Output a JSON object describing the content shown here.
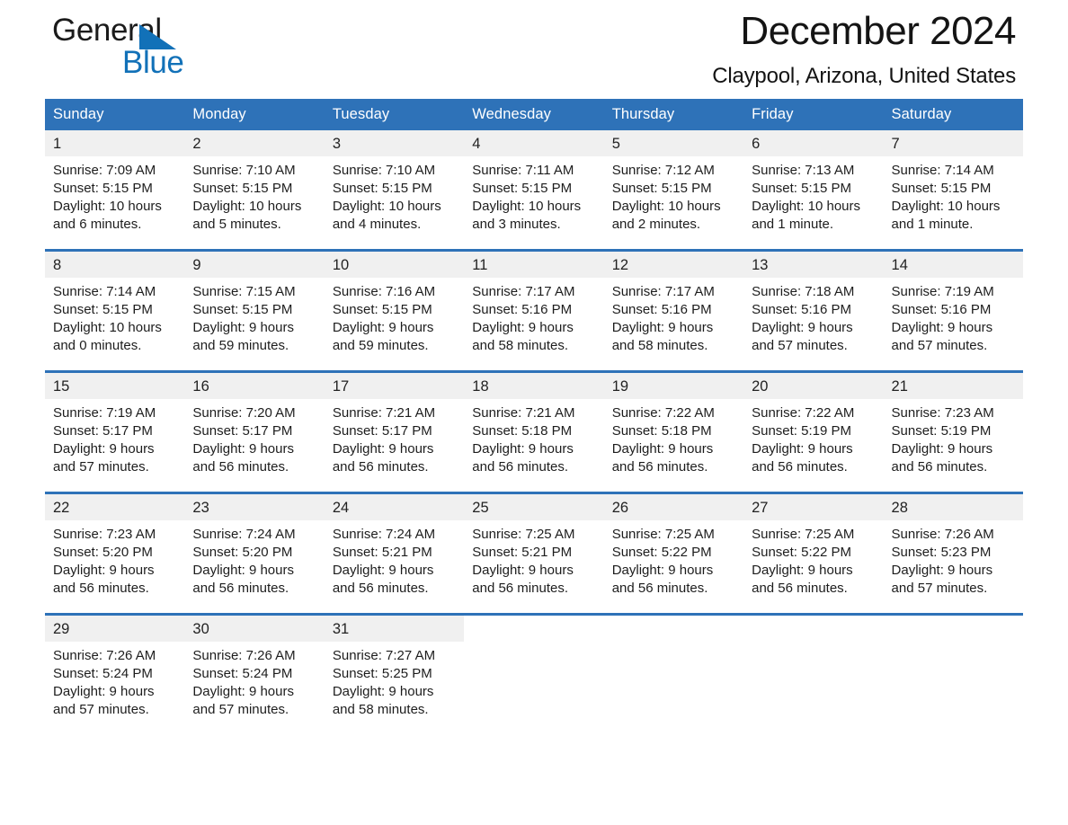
{
  "brand": {
    "word1": "General",
    "word2": "Blue",
    "accent_color": "#1271b8"
  },
  "header": {
    "month_title": "December 2024",
    "location": "Claypool, Arizona, United States",
    "header_bg_color": "#2e72b8",
    "daynum_bg_color": "#f0f0f0"
  },
  "weekday_headers": [
    "Sunday",
    "Monday",
    "Tuesday",
    "Wednesday",
    "Thursday",
    "Friday",
    "Saturday"
  ],
  "weeks": [
    {
      "days": [
        {
          "num": "1",
          "sunrise": "Sunrise: 7:09 AM",
          "sunset": "Sunset: 5:15 PM",
          "daylight1": "Daylight: 10 hours",
          "daylight2": "and 6 minutes."
        },
        {
          "num": "2",
          "sunrise": "Sunrise: 7:10 AM",
          "sunset": "Sunset: 5:15 PM",
          "daylight1": "Daylight: 10 hours",
          "daylight2": "and 5 minutes."
        },
        {
          "num": "3",
          "sunrise": "Sunrise: 7:10 AM",
          "sunset": "Sunset: 5:15 PM",
          "daylight1": "Daylight: 10 hours",
          "daylight2": "and 4 minutes."
        },
        {
          "num": "4",
          "sunrise": "Sunrise: 7:11 AM",
          "sunset": "Sunset: 5:15 PM",
          "daylight1": "Daylight: 10 hours",
          "daylight2": "and 3 minutes."
        },
        {
          "num": "5",
          "sunrise": "Sunrise: 7:12 AM",
          "sunset": "Sunset: 5:15 PM",
          "daylight1": "Daylight: 10 hours",
          "daylight2": "and 2 minutes."
        },
        {
          "num": "6",
          "sunrise": "Sunrise: 7:13 AM",
          "sunset": "Sunset: 5:15 PM",
          "daylight1": "Daylight: 10 hours",
          "daylight2": "and 1 minute."
        },
        {
          "num": "7",
          "sunrise": "Sunrise: 7:14 AM",
          "sunset": "Sunset: 5:15 PM",
          "daylight1": "Daylight: 10 hours",
          "daylight2": "and 1 minute."
        }
      ]
    },
    {
      "days": [
        {
          "num": "8",
          "sunrise": "Sunrise: 7:14 AM",
          "sunset": "Sunset: 5:15 PM",
          "daylight1": "Daylight: 10 hours",
          "daylight2": "and 0 minutes."
        },
        {
          "num": "9",
          "sunrise": "Sunrise: 7:15 AM",
          "sunset": "Sunset: 5:15 PM",
          "daylight1": "Daylight: 9 hours",
          "daylight2": "and 59 minutes."
        },
        {
          "num": "10",
          "sunrise": "Sunrise: 7:16 AM",
          "sunset": "Sunset: 5:15 PM",
          "daylight1": "Daylight: 9 hours",
          "daylight2": "and 59 minutes."
        },
        {
          "num": "11",
          "sunrise": "Sunrise: 7:17 AM",
          "sunset": "Sunset: 5:16 PM",
          "daylight1": "Daylight: 9 hours",
          "daylight2": "and 58 minutes."
        },
        {
          "num": "12",
          "sunrise": "Sunrise: 7:17 AM",
          "sunset": "Sunset: 5:16 PM",
          "daylight1": "Daylight: 9 hours",
          "daylight2": "and 58 minutes."
        },
        {
          "num": "13",
          "sunrise": "Sunrise: 7:18 AM",
          "sunset": "Sunset: 5:16 PM",
          "daylight1": "Daylight: 9 hours",
          "daylight2": "and 57 minutes."
        },
        {
          "num": "14",
          "sunrise": "Sunrise: 7:19 AM",
          "sunset": "Sunset: 5:16 PM",
          "daylight1": "Daylight: 9 hours",
          "daylight2": "and 57 minutes."
        }
      ]
    },
    {
      "days": [
        {
          "num": "15",
          "sunrise": "Sunrise: 7:19 AM",
          "sunset": "Sunset: 5:17 PM",
          "daylight1": "Daylight: 9 hours",
          "daylight2": "and 57 minutes."
        },
        {
          "num": "16",
          "sunrise": "Sunrise: 7:20 AM",
          "sunset": "Sunset: 5:17 PM",
          "daylight1": "Daylight: 9 hours",
          "daylight2": "and 56 minutes."
        },
        {
          "num": "17",
          "sunrise": "Sunrise: 7:21 AM",
          "sunset": "Sunset: 5:17 PM",
          "daylight1": "Daylight: 9 hours",
          "daylight2": "and 56 minutes."
        },
        {
          "num": "18",
          "sunrise": "Sunrise: 7:21 AM",
          "sunset": "Sunset: 5:18 PM",
          "daylight1": "Daylight: 9 hours",
          "daylight2": "and 56 minutes."
        },
        {
          "num": "19",
          "sunrise": "Sunrise: 7:22 AM",
          "sunset": "Sunset: 5:18 PM",
          "daylight1": "Daylight: 9 hours",
          "daylight2": "and 56 minutes."
        },
        {
          "num": "20",
          "sunrise": "Sunrise: 7:22 AM",
          "sunset": "Sunset: 5:19 PM",
          "daylight1": "Daylight: 9 hours",
          "daylight2": "and 56 minutes."
        },
        {
          "num": "21",
          "sunrise": "Sunrise: 7:23 AM",
          "sunset": "Sunset: 5:19 PM",
          "daylight1": "Daylight: 9 hours",
          "daylight2": "and 56 minutes."
        }
      ]
    },
    {
      "days": [
        {
          "num": "22",
          "sunrise": "Sunrise: 7:23 AM",
          "sunset": "Sunset: 5:20 PM",
          "daylight1": "Daylight: 9 hours",
          "daylight2": "and 56 minutes."
        },
        {
          "num": "23",
          "sunrise": "Sunrise: 7:24 AM",
          "sunset": "Sunset: 5:20 PM",
          "daylight1": "Daylight: 9 hours",
          "daylight2": "and 56 minutes."
        },
        {
          "num": "24",
          "sunrise": "Sunrise: 7:24 AM",
          "sunset": "Sunset: 5:21 PM",
          "daylight1": "Daylight: 9 hours",
          "daylight2": "and 56 minutes."
        },
        {
          "num": "25",
          "sunrise": "Sunrise: 7:25 AM",
          "sunset": "Sunset: 5:21 PM",
          "daylight1": "Daylight: 9 hours",
          "daylight2": "and 56 minutes."
        },
        {
          "num": "26",
          "sunrise": "Sunrise: 7:25 AM",
          "sunset": "Sunset: 5:22 PM",
          "daylight1": "Daylight: 9 hours",
          "daylight2": "and 56 minutes."
        },
        {
          "num": "27",
          "sunrise": "Sunrise: 7:25 AM",
          "sunset": "Sunset: 5:22 PM",
          "daylight1": "Daylight: 9 hours",
          "daylight2": "and 56 minutes."
        },
        {
          "num": "28",
          "sunrise": "Sunrise: 7:26 AM",
          "sunset": "Sunset: 5:23 PM",
          "daylight1": "Daylight: 9 hours",
          "daylight2": "and 57 minutes."
        }
      ]
    },
    {
      "days": [
        {
          "num": "29",
          "sunrise": "Sunrise: 7:26 AM",
          "sunset": "Sunset: 5:24 PM",
          "daylight1": "Daylight: 9 hours",
          "daylight2": "and 57 minutes."
        },
        {
          "num": "30",
          "sunrise": "Sunrise: 7:26 AM",
          "sunset": "Sunset: 5:24 PM",
          "daylight1": "Daylight: 9 hours",
          "daylight2": "and 57 minutes."
        },
        {
          "num": "31",
          "sunrise": "Sunrise: 7:27 AM",
          "sunset": "Sunset: 5:25 PM",
          "daylight1": "Daylight: 9 hours",
          "daylight2": "and 58 minutes."
        },
        {
          "num": "",
          "sunrise": "",
          "sunset": "",
          "daylight1": "",
          "daylight2": ""
        },
        {
          "num": "",
          "sunrise": "",
          "sunset": "",
          "daylight1": "",
          "daylight2": ""
        },
        {
          "num": "",
          "sunrise": "",
          "sunset": "",
          "daylight1": "",
          "daylight2": ""
        },
        {
          "num": "",
          "sunrise": "",
          "sunset": "",
          "daylight1": "",
          "daylight2": ""
        }
      ]
    }
  ]
}
